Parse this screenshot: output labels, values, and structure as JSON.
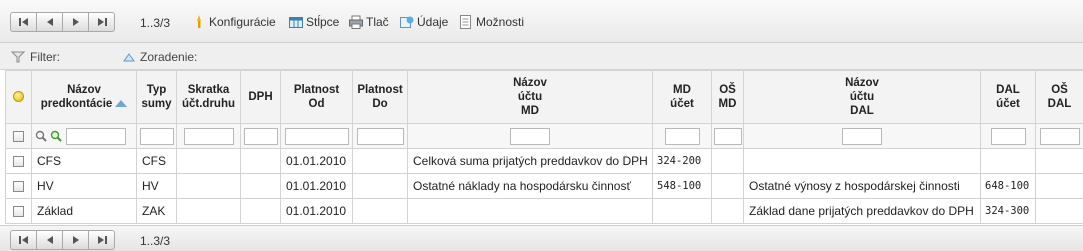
{
  "toolbar": {
    "pager_info": "1..3/3",
    "links": [
      {
        "label": "Konfigurácie",
        "icon": "config-icon"
      },
      {
        "label": "Stĺpce",
        "icon": "columns-icon"
      },
      {
        "label": "Tlač",
        "icon": "print-icon"
      },
      {
        "label": "Údaje",
        "icon": "data-icon"
      },
      {
        "label": "Možnosti",
        "icon": "options-icon"
      }
    ]
  },
  "filterbar": {
    "filter_label": "Filter:",
    "sort_label": "Zoradenie:"
  },
  "columns": [
    {
      "label": "Názov\npredkontácie"
    },
    {
      "label": "Typ\nsumy"
    },
    {
      "label": "Skratka\núčt.druhu"
    },
    {
      "label": "DPH"
    },
    {
      "label": "Platnost\nOd"
    },
    {
      "label": "Platnost\nDo"
    },
    {
      "label": "Názov\núčtu\nMD"
    },
    {
      "label": "MD\núčet"
    },
    {
      "label": "OŠ\nMD"
    },
    {
      "label": "Názov\núčtu\nDAL"
    },
    {
      "label": "DAL\núčet"
    },
    {
      "label": "OŠ\nDAL"
    }
  ],
  "rows": [
    [
      "CFS",
      "CFS",
      "",
      "",
      "01.01.2010",
      "",
      "Celková suma prijatých preddavkov do DPH",
      "324-200",
      "",
      "",
      "",
      ""
    ],
    [
      "HV",
      "HV",
      "",
      "",
      "01.01.2010",
      "",
      "Ostatné náklady na hospodársku činnosť",
      "548-100",
      "",
      "Ostatné výnosy z hospodárskej činnosti",
      "648-100",
      ""
    ],
    [
      "Základ",
      "ZAK",
      "",
      "",
      "01.01.2010",
      "",
      "",
      "",
      "",
      "Základ dane prijatých preddavkov do DPH",
      "324-300",
      ""
    ]
  ],
  "footer": {
    "pager_info": "1..3/3"
  },
  "colors": {
    "sort_arrow": "#6ea7d6",
    "status_dot": "#e8b400"
  }
}
